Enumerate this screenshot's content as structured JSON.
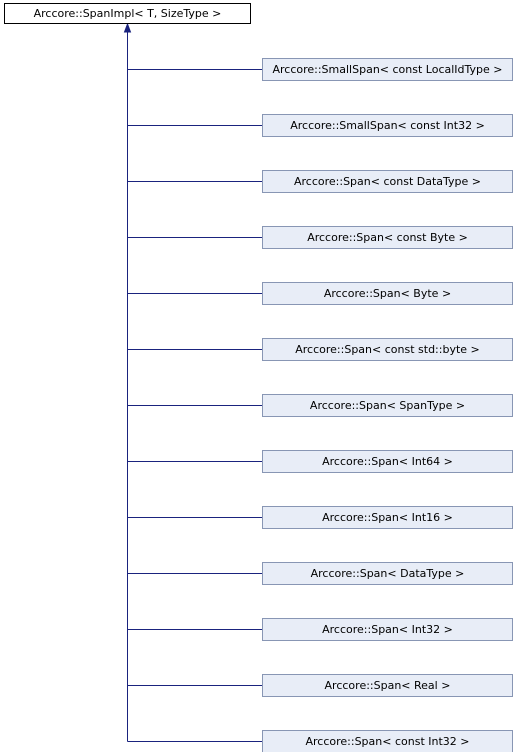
{
  "diagram": {
    "type": "inheritance",
    "base": {
      "label": "Arccore::SpanImpl< T, SizeType >"
    },
    "derived": [
      {
        "label": "Arccore::SmallSpan< const LocalIdType >"
      },
      {
        "label": "Arccore::SmallSpan< const Int32 >"
      },
      {
        "label": "Arccore::Span< const DataType >"
      },
      {
        "label": "Arccore::Span< const Byte >"
      },
      {
        "label": "Arccore::Span< Byte >"
      },
      {
        "label": "Arccore::Span< const std::byte >"
      },
      {
        "label": "Arccore::Span< SpanType >"
      },
      {
        "label": "Arccore::Span< Int64 >"
      },
      {
        "label": "Arccore::Span< Int16 >"
      },
      {
        "label": "Arccore::Span< DataType >"
      },
      {
        "label": "Arccore::Span< Int32 >"
      },
      {
        "label": "Arccore::Span< Real >"
      },
      {
        "label": "Arccore::Span< const Int32 >"
      }
    ],
    "colors": {
      "edge": "#1a237e",
      "derived_fill": "#e8edf7",
      "derived_stroke": "#8896b4",
      "base_fill": "#ffffff",
      "base_stroke": "#000000"
    }
  }
}
